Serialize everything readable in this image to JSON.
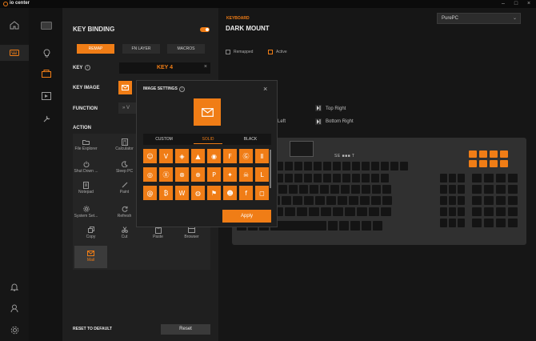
{
  "app": {
    "title": "io center"
  },
  "colors": {
    "accent": "#f07d16",
    "panel": "#1f1f1f",
    "background": "#131313"
  },
  "key_binding": {
    "title": "KEY BINDING",
    "tabs": [
      {
        "label": "REMAP",
        "active": true
      },
      {
        "label": "FN LAYER",
        "active": false
      },
      {
        "label": "MACROS",
        "active": false
      }
    ],
    "key_label": "KEY",
    "key_value": "KEY 4",
    "key_image_label": "KEY IMAGE",
    "function_label": "FUNCTION",
    "function_value": "V",
    "action_label": "ACTION",
    "actions": [
      {
        "label": "",
        "icon": "blank"
      },
      {
        "label": "File Explorer",
        "icon": "folder-icon"
      },
      {
        "label": "Calculator",
        "icon": "calculator-icon"
      },
      {
        "label": "",
        "icon": "blank"
      },
      {
        "label": "Shut Down ...",
        "icon": "power-icon"
      },
      {
        "label": "Sleep PC",
        "icon": "moon-icon"
      },
      {
        "label": "Notepad",
        "icon": "notepad-icon"
      },
      {
        "label": "Paint",
        "icon": "brush-icon"
      },
      {
        "label": "System Set...",
        "icon": "gear-icon"
      },
      {
        "label": "Refresh",
        "icon": "refresh-icon"
      },
      {
        "label": "Paste",
        "icon": "paste-icon"
      },
      {
        "label": "Browser",
        "icon": "globe-icon"
      },
      {
        "label": "Copy",
        "icon": "copy-icon"
      },
      {
        "label": "Cut",
        "icon": "cut-icon"
      },
      {
        "label": "Mail",
        "icon": "mail-icon"
      }
    ],
    "reset_label": "RESET TO DEFAULT",
    "reset_button": "Reset"
  },
  "keyboard": {
    "section_label": "KEYBOARD",
    "device_name": "DARK MOUNT",
    "device_select": "PurePC",
    "legend_remapped": "Remapped",
    "legend_active": "Active",
    "positions": {
      "top_right": "Top Right",
      "bottom_right": "Bottom Right",
      "left": "Left"
    },
    "brand": "SE ■■■ T"
  },
  "image_settings": {
    "title": "IMAGE SETTINGS",
    "tabs": [
      {
        "label": "CUSTOM",
        "active": false
      },
      {
        "label": "SOLID",
        "active": true
      },
      {
        "label": "BLACK",
        "active": false
      }
    ],
    "icons": [
      "headset-icon",
      "valorant-icon",
      "dota-icon",
      "apex-icon",
      "overwatch-icon",
      "fortnite-icon",
      "gta-icon",
      "pause-icon",
      "steam-icon",
      "xbox-icon",
      "xbox-circle-icon",
      "csgo-icon",
      "pubg-icon",
      "hearthstone-icon",
      "dead-icon",
      "league-icon",
      "swirl-icon",
      "bitcoin-icon",
      "wow-icon",
      "spotify-icon",
      "runner-icon",
      "discord-icon",
      "facebook-icon",
      "instagram-icon"
    ],
    "apply_button": "Apply"
  }
}
